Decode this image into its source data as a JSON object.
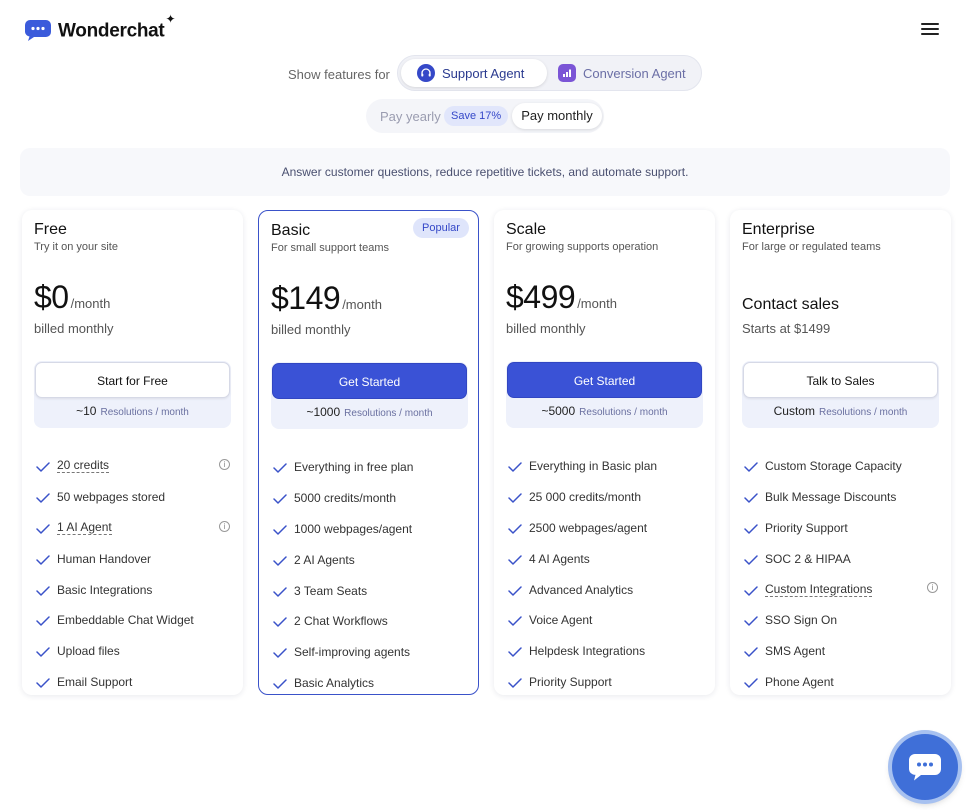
{
  "header": {
    "brand": "Wonderchat",
    "brand_mark": "✦"
  },
  "feature_toggle": {
    "label": "Show features for",
    "options": [
      "Support Agent",
      "Conversion Agent"
    ],
    "active": "Support Agent"
  },
  "billing_toggle": {
    "yearly": "Pay yearly",
    "save": "Save 17%",
    "monthly": "Pay monthly",
    "active": "Pay monthly"
  },
  "description": "Answer customer questions, reduce repetitive tickets, and automate support.",
  "plans": [
    {
      "name": "Free",
      "subtitle": "Try it on your site",
      "price": "$0",
      "per": "/month",
      "billed": "billed monthly",
      "cta": "Start for Free",
      "resolutions": "~10",
      "resolutions_unit": "Resolutions / month",
      "features": [
        "20 credits",
        "50 webpages stored",
        "1 AI Agent",
        "Human Handover",
        "Basic Integrations",
        "Embeddable Chat Widget",
        "Upload files",
        "Email Support"
      ]
    },
    {
      "name": "Basic",
      "subtitle": "For small support teams",
      "badge": "Popular",
      "price": "$149",
      "per": "/month",
      "billed": "billed monthly",
      "cta": "Get Started",
      "resolutions": "~1000",
      "resolutions_unit": "Resolutions / month",
      "features": [
        "Everything in free plan",
        "5000 credits/month",
        "1000 webpages/agent",
        "2 AI Agents",
        "3 Team Seats",
        "2 Chat Workflows",
        "Self-improving agents",
        "Basic Analytics"
      ]
    },
    {
      "name": "Scale",
      "subtitle": "For growing supports operation",
      "price": "$499",
      "per": "/month",
      "billed": "billed monthly",
      "cta": "Get Started",
      "resolutions": "~5000",
      "resolutions_unit": "Resolutions / month",
      "features": [
        "Everything in Basic plan",
        "25 000 credits/month",
        "2500 webpages/agent",
        "4 AI Agents",
        "Advanced Analytics",
        "Voice Agent",
        "Helpdesk Integrations",
        "Priority Support"
      ]
    },
    {
      "name": "Enterprise",
      "subtitle": "For large or regulated teams",
      "contact": "Contact sales",
      "billed": "Starts at $1499",
      "cta": "Talk to Sales",
      "resolutions": "Custom",
      "resolutions_unit": "Resolutions / month",
      "features": [
        "Custom Storage Capacity",
        "Bulk Message Discounts",
        "Priority Support",
        "SOC 2 & HIPAA",
        "Custom Integrations",
        "SSO Sign On",
        "SMS Agent",
        "Phone Agent"
      ]
    }
  ],
  "colors": {
    "accent": "#3a52d6",
    "accent_light": "#eef1fb",
    "check": "#3a52c9"
  }
}
